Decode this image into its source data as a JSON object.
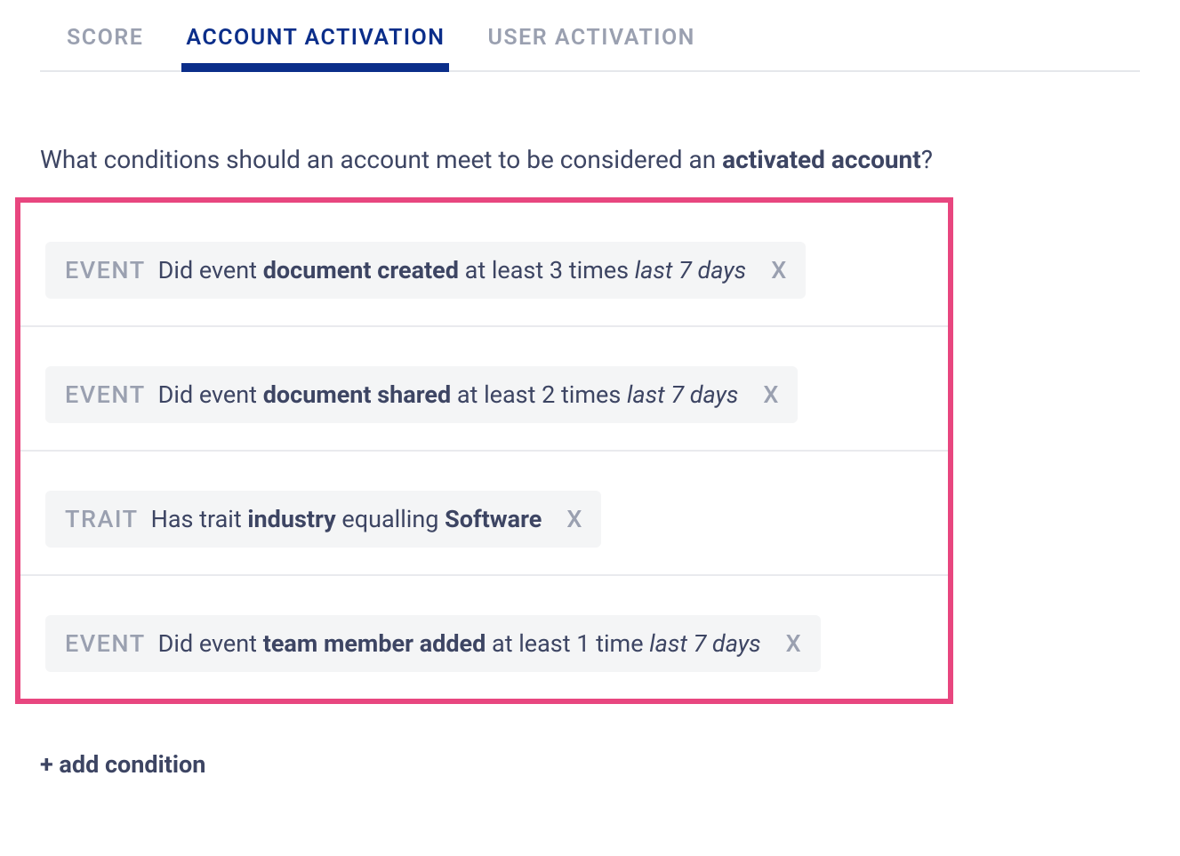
{
  "tabs": [
    {
      "label": "SCORE",
      "active": false
    },
    {
      "label": "ACCOUNT ACTIVATION",
      "active": true
    },
    {
      "label": "USER ACTIVATION",
      "active": false
    }
  ],
  "question": {
    "prefix": "What conditions should an account meet to be considered an ",
    "bold": "activated account",
    "suffix": "?"
  },
  "conditions": [
    {
      "type": "EVENT",
      "prefix": "Did event ",
      "bold1": "document created",
      "middle": " at least 3 times ",
      "italic": "last 7 days",
      "close": "X"
    },
    {
      "type": "EVENT",
      "prefix": "Did event ",
      "bold1": "document shared",
      "middle": " at least 2 times ",
      "italic": "last 7 days",
      "close": "X"
    },
    {
      "type": "TRAIT",
      "prefix": "Has trait ",
      "bold1": "industry",
      "middle": " equalling ",
      "bold2": "Software",
      "close": "X"
    },
    {
      "type": "EVENT",
      "prefix": "Did event ",
      "bold1": "team member added",
      "middle": " at least 1 time ",
      "italic": "last 7 days",
      "close": "X"
    }
  ],
  "add_condition_label": "+ add condition"
}
